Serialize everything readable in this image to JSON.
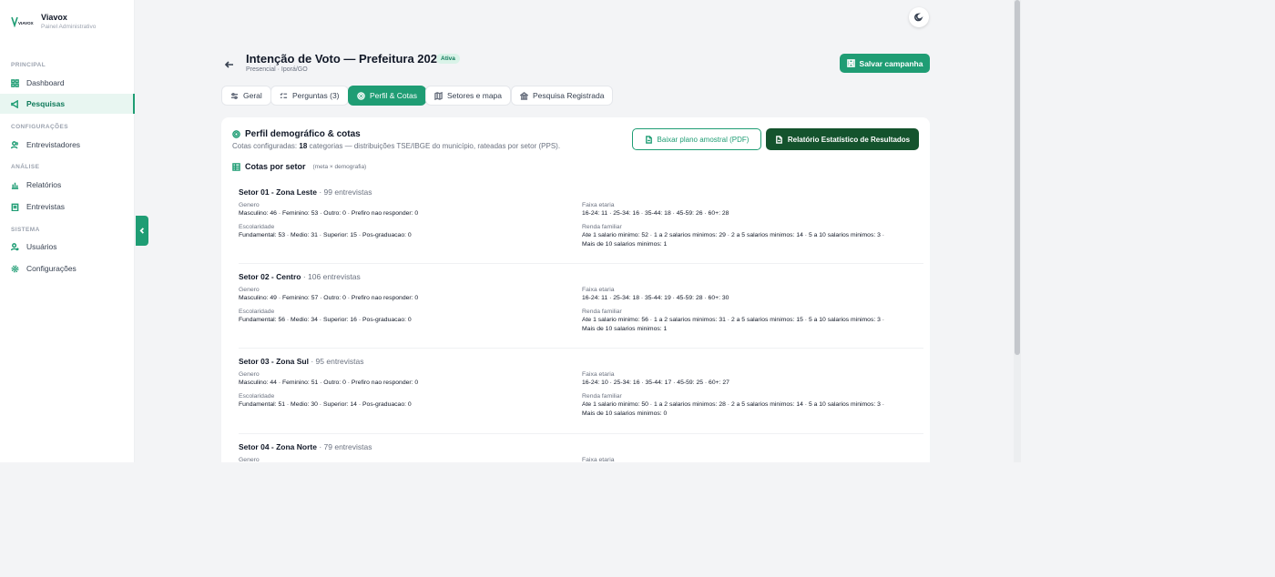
{
  "brand": {
    "name": "Viavox",
    "subtitle": "Painel Administrativo",
    "logo_text": "VIAVOX"
  },
  "sidebar": {
    "sections": [
      {
        "title": "PRINCIPAL"
      },
      {
        "title": "CONFIGURAÇÕES"
      },
      {
        "title": "ANÁLISE"
      },
      {
        "title": "SISTEMA"
      }
    ],
    "items": [
      {
        "label": "Dashboard",
        "icon": "grid-icon"
      },
      {
        "label": "Pesquisas",
        "icon": "megaphone-icon",
        "active": true
      },
      {
        "label": "Entrevistadores",
        "icon": "users-icon"
      },
      {
        "label": "Relatórios",
        "icon": "bar-chart-icon"
      },
      {
        "label": "Entrevistas",
        "icon": "clipboard-icon"
      },
      {
        "label": "Usuários",
        "icon": "user-plus-icon"
      },
      {
        "label": "Configurações",
        "icon": "gear-icon"
      }
    ]
  },
  "header": {
    "title": "Intenção de Voto — Prefeitura 2028",
    "badge": "Ativa",
    "subtitle": "Presencial · Iporá/GO",
    "save_label": "Salvar campanha"
  },
  "tabs": [
    {
      "label": "Geral",
      "icon": "sliders-icon"
    },
    {
      "label": "Perguntas (3)",
      "icon": "list-icon"
    },
    {
      "label": "Perfil & Cotas",
      "icon": "target-icon",
      "active": true
    },
    {
      "label": "Setores e mapa",
      "icon": "map-icon"
    },
    {
      "label": "Pesquisa Registrada",
      "icon": "building-icon"
    }
  ],
  "profile": {
    "title": "Perfil demográfico & cotas",
    "desc_prefix": "Cotas configuradas: ",
    "desc_count": "18",
    "desc_suffix": " categorias — distribuições TSE/IBGE do município, rateadas por setor (PPS).",
    "pdf_label": "Baixar plano amostral (PDF)",
    "report_label": "Relatório Estatístico de Resultados",
    "section_title": "Cotas por setor",
    "section_note": "(meta × demografia)"
  },
  "labels": {
    "genero": "Genero",
    "faixa": "Faixa etaria",
    "escolaridade": "Escolaridade",
    "renda": "Renda familiar"
  },
  "sectors": [
    {
      "name": "Setor 01 - Zona Leste",
      "count": " · 99 entrevistas",
      "genero": "Masculino: 46 · Feminino: 53 · Outro: 0 · Prefiro nao responder: 0",
      "faixa": "16-24: 11 · 25-34: 16 · 35-44: 18 · 45-59: 26 · 60+: 28",
      "escolaridade": "Fundamental: 53 · Medio: 31 · Superior: 15 · Pos-graduacao: 0",
      "renda1": "Ate 1 salario minimo: 52 · 1 a 2 salarios minimos: 29 · 2 a 5 salarios minimos: 14 · 5 a 10 salarios minimos: 3 ·",
      "renda2": "Mais de 10 salarios minimos: 1"
    },
    {
      "name": "Setor 02 - Centro",
      "count": " · 106 entrevistas",
      "genero": "Masculino: 49 · Feminino: 57 · Outro: 0 · Prefiro nao responder: 0",
      "faixa": "16-24: 11 · 25-34: 18 · 35-44: 19 · 45-59: 28 · 60+: 30",
      "escolaridade": "Fundamental: 56 · Medio: 34 · Superior: 16 · Pos-graduacao: 0",
      "renda1": "Ate 1 salario minimo: 56 · 1 a 2 salarios minimos: 31 · 2 a 5 salarios minimos: 15 · 5 a 10 salarios minimos: 3 ·",
      "renda2": "Mais de 10 salarios minimos: 1"
    },
    {
      "name": "Setor 03 - Zona Sul",
      "count": " · 95 entrevistas",
      "genero": "Masculino: 44 · Feminino: 51 · Outro: 0 · Prefiro nao responder: 0",
      "faixa": "16-24: 10 · 25-34: 16 · 35-44: 17 · 45-59: 25 · 60+: 27",
      "escolaridade": "Fundamental: 51 · Medio: 30 · Superior: 14 · Pos-graduacao: 0",
      "renda1": "Ate 1 salario minimo: 50 · 1 a 2 salarios minimos: 28 · 2 a 5 salarios minimos: 14 · 5 a 10 salarios minimos: 3 ·",
      "renda2": "Mais de 10 salarios minimos: 0"
    },
    {
      "name": "Setor 04 - Zona Norte",
      "count": " · 79 entrevistas"
    }
  ],
  "colors": {
    "accent": "#1f9d74",
    "dark_green": "#14532d",
    "active_bg": "#e8f6f1"
  }
}
